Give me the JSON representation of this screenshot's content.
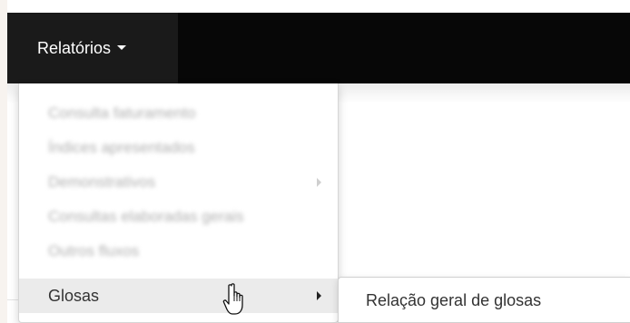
{
  "navbar": {
    "menu_label": "Relatórios",
    "caret_icon": "caret-down-icon",
    "background": "#070707",
    "active_background": "#1a1a1a"
  },
  "dropdown": {
    "items": [
      {
        "label": "Consulta faturamento",
        "blurred": true,
        "has_submenu": false
      },
      {
        "label": "Índices apresentados",
        "blurred": true,
        "has_submenu": false
      },
      {
        "label": "Demonstrativos",
        "blurred": true,
        "has_submenu": true
      },
      {
        "label": "Consultas elaboradas gerais",
        "blurred": true,
        "has_submenu": false
      },
      {
        "label": "Outros fluxos",
        "blurred": true,
        "has_submenu": false
      },
      {
        "label": "Glosas",
        "blurred": false,
        "has_submenu": true,
        "hovered": true
      }
    ],
    "submenu_icon": "caret-right-icon"
  },
  "submenu": {
    "items": [
      {
        "label": "Relação geral de glosas"
      }
    ]
  },
  "cursor": {
    "icon": "hand-pointer-icon"
  }
}
